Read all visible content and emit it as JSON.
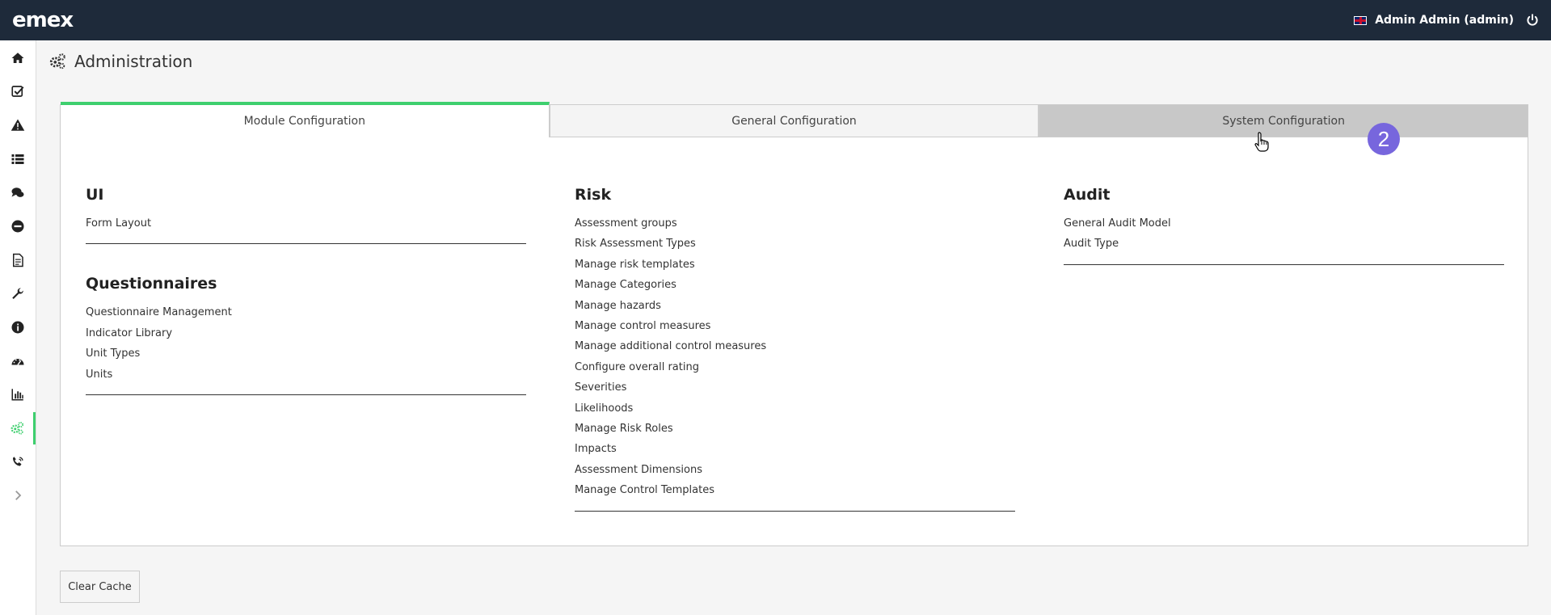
{
  "app": {
    "logo": "emex",
    "user_label": "Admin Admin (admin)",
    "accent_color": "#3ecf6e",
    "topbar_color": "#1e2a3a"
  },
  "sidebar": {
    "items": [
      {
        "icon": "home-icon"
      },
      {
        "icon": "checkbox-icon"
      },
      {
        "icon": "warning-icon"
      },
      {
        "icon": "list-icon"
      },
      {
        "icon": "comments-icon"
      },
      {
        "icon": "minus-circle-icon"
      },
      {
        "icon": "document-icon"
      },
      {
        "icon": "wrench-icon"
      },
      {
        "icon": "info-icon"
      },
      {
        "icon": "dashboard-icon"
      },
      {
        "icon": "bar-chart-icon"
      },
      {
        "icon": "gears-icon",
        "active": true
      },
      {
        "icon": "phone-icon"
      },
      {
        "icon": "chevron-right-icon"
      }
    ]
  },
  "page": {
    "title": "Administration"
  },
  "tabs": [
    {
      "label": "Module Configuration",
      "active": true
    },
    {
      "label": "General Configuration"
    },
    {
      "label": "System Configuration"
    }
  ],
  "columns": {
    "ui": {
      "title": "UI",
      "links": [
        "Form Layout"
      ]
    },
    "questionnaires": {
      "title": "Questionnaires",
      "links": [
        "Questionnaire Management",
        "Indicator Library",
        "Unit Types",
        "Units"
      ]
    },
    "risk": {
      "title": "Risk",
      "links": [
        "Assessment groups",
        "Risk Assessment Types",
        "Manage risk templates",
        "Manage Categories",
        "Manage hazards",
        "Manage control measures",
        "Manage additional control measures",
        "Configure overall rating",
        "Severities",
        "Likelihoods",
        "Manage Risk Roles",
        "Impacts",
        "Assessment Dimensions",
        "Manage Control Templates"
      ]
    },
    "audit": {
      "title": "Audit",
      "links": [
        "General Audit Model",
        "Audit Type"
      ]
    }
  },
  "actions": {
    "clear_cache": "Clear Cache"
  },
  "step_badge": "2"
}
